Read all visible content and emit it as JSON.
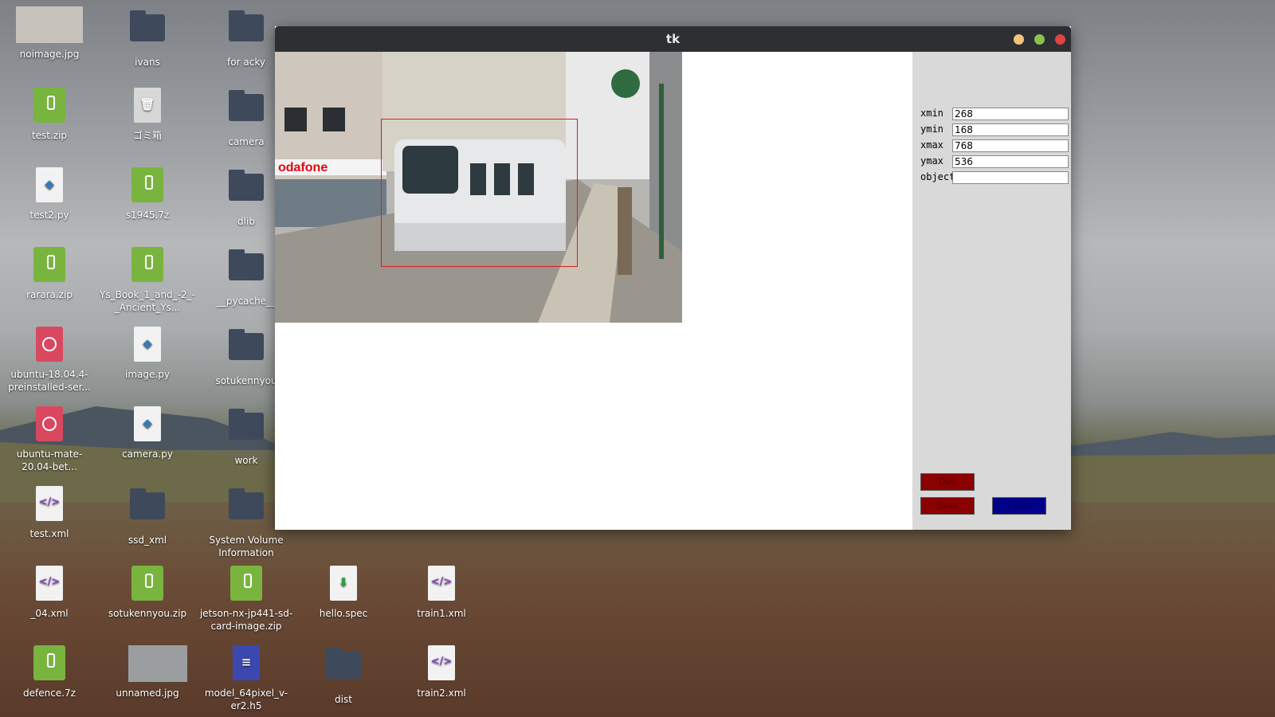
{
  "desktop": {
    "icons": [
      {
        "label": "noimage.jpg"
      },
      {
        "label": "ivans"
      },
      {
        "label": "for acky"
      },
      {
        "label": "test.zip"
      },
      {
        "label": "ゴミ箱"
      },
      {
        "label": "camera"
      },
      {
        "label": "test2.py"
      },
      {
        "label": "s1945.7z"
      },
      {
        "label": "dlib"
      },
      {
        "label": "rarara.zip"
      },
      {
        "label": "Ys_Book_1_and_-2_-_Ancient_Ys..."
      },
      {
        "label": "__pycache__"
      },
      {
        "label": "ubuntu-18.04.4-preinstalled-ser..."
      },
      {
        "label": "image.py"
      },
      {
        "label": "sotukennyou"
      },
      {
        "label": "ubuntu-mate-20.04-bet..."
      },
      {
        "label": "camera.py"
      },
      {
        "label": "work"
      },
      {
        "label": "test.xml"
      },
      {
        "label": "ssd_xml"
      },
      {
        "label": "System Volume Information"
      },
      {
        "label": "_04.xml"
      },
      {
        "label": "sotukennyou.zip"
      },
      {
        "label": "jetson-nx-jp441-sd-card-image.zip"
      },
      {
        "label": "hello.spec"
      },
      {
        "label": "train1.xml"
      },
      {
        "label": "defence.7z"
      },
      {
        "label": "unnamed.jpg"
      },
      {
        "label": "model_64pixel_v-er2.h5"
      },
      {
        "label": "dist"
      },
      {
        "label": "train2.xml"
      }
    ]
  },
  "window": {
    "title": "tk",
    "colors": {
      "minimize": "#f2c57c",
      "maximize": "#8bc34a",
      "close": "#e0443e",
      "bbox": "#e01b1b"
    }
  },
  "form": {
    "xmin": {
      "label": "xmin",
      "value": "268"
    },
    "ymin": {
      "label": "ymin",
      "value": "168"
    },
    "xmax": {
      "label": "xmax",
      "value": "768"
    },
    "ymax": {
      "label": "ymax",
      "value": "536"
    },
    "object": {
      "label": "object",
      "value": ""
    }
  },
  "buttons": {
    "dub": "Dub",
    "save": "Save",
    "open": "Open",
    "colors": {
      "dub": "#8b0000",
      "save": "#8b0000",
      "open": "#00008b"
    }
  }
}
